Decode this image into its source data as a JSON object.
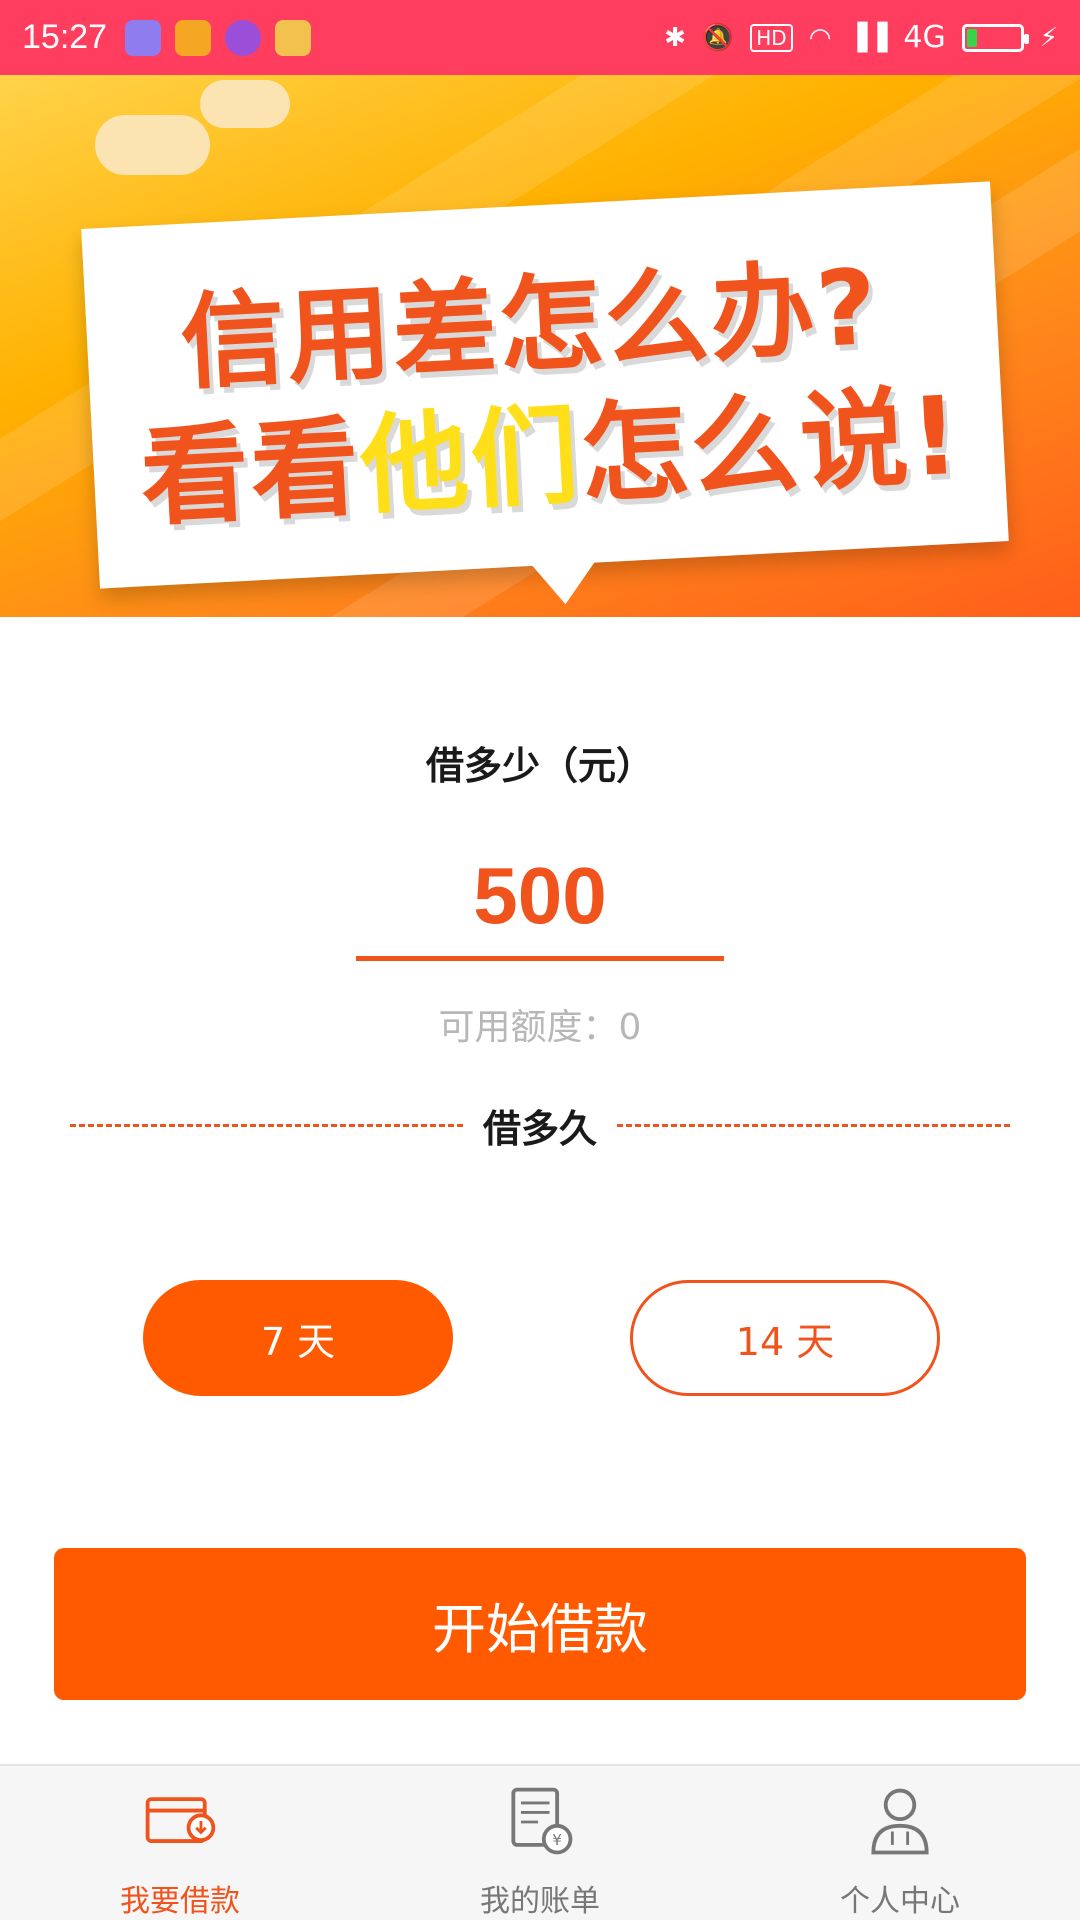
{
  "status_bar": {
    "time": "15:27",
    "network_label": "4G",
    "hd_label": "HD",
    "battery_level": 0.2,
    "app_icons": [
      "wechat-icon",
      "game-icon",
      "browser-icon",
      "ball-icon"
    ]
  },
  "banner": {
    "line1": "信用差怎么办?",
    "line2_part1": "看看",
    "line2_highlight": "他们",
    "line2_part2": "怎么说!"
  },
  "loan": {
    "amount_label": "借多少（元）",
    "amount_value": "500",
    "available_label": "可用额度：0",
    "duration_label": "借多久",
    "durations": [
      {
        "label": "7 天",
        "selected": true
      },
      {
        "label": "14 天",
        "selected": false
      }
    ],
    "start_button": "开始借款"
  },
  "tab_bar": {
    "items": [
      {
        "label": "我要借款",
        "icon": "wallet-icon",
        "active": true
      },
      {
        "label": "我的账单",
        "icon": "bill-icon",
        "active": false
      },
      {
        "label": "个人中心",
        "icon": "user-icon",
        "active": false
      }
    ]
  },
  "colors": {
    "status_bar": "#ff3d5f",
    "accent": "#ff5a00",
    "accent_text": "#f0531c",
    "muted_text": "#b7b7b7"
  }
}
